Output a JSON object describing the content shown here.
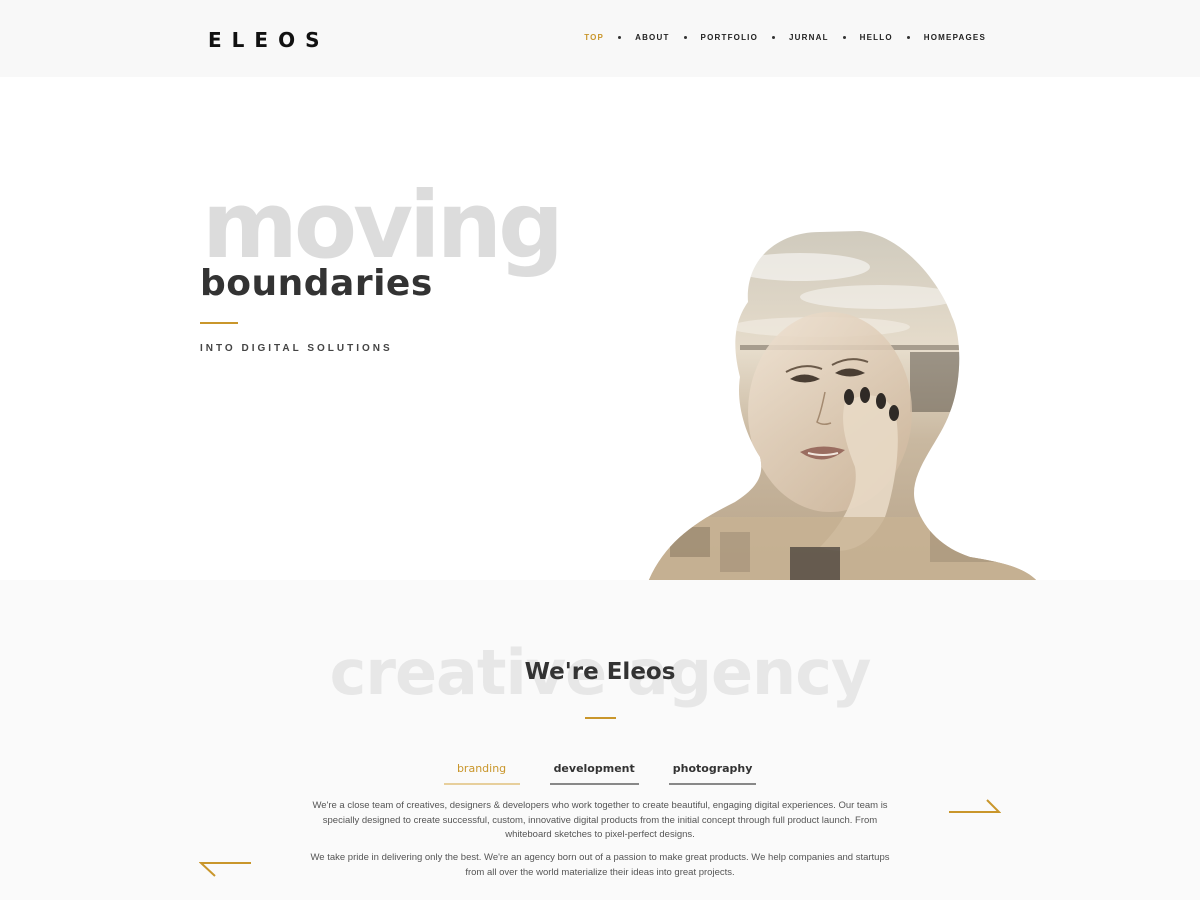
{
  "brand": {
    "logo": "ELEOS",
    "accent": "#c9962b"
  },
  "nav": {
    "items": [
      {
        "label": "TOP",
        "active": true
      },
      {
        "label": "ABOUT",
        "active": false
      },
      {
        "label": "PORTFOLIO",
        "active": false
      },
      {
        "label": "JURNAL",
        "active": false
      },
      {
        "label": "HELLO",
        "active": false
      },
      {
        "label": "HOMEPAGES",
        "active": false
      }
    ]
  },
  "hero": {
    "background_word": "moving",
    "title": "boundaries",
    "subtitle": "INTO DIGITAL SOLUTIONS",
    "image_icon": "double-exposure-portrait"
  },
  "about": {
    "background_word": "creative agency",
    "title": "We're Eleos",
    "tabs": [
      {
        "label": "branding",
        "active": true
      },
      {
        "label": "development",
        "active": false
      },
      {
        "label": "photography",
        "active": false
      }
    ],
    "paragraphs": [
      "We're a close team of creatives, designers & developers who work together to create beautiful, engaging digital experiences. Our team is specially designed to create successful, custom, innovative digital products from the initial concept through full product launch. From whiteboard sketches to pixel-perfect designs.",
      "We take pride in delivering only the best. We're an agency born out of a passion to make great products. We help companies and startups from all over the world materialize their ideas into great projects."
    ],
    "next_icon": "arrow-right-icon",
    "prev_icon": "arrow-left-icon"
  }
}
